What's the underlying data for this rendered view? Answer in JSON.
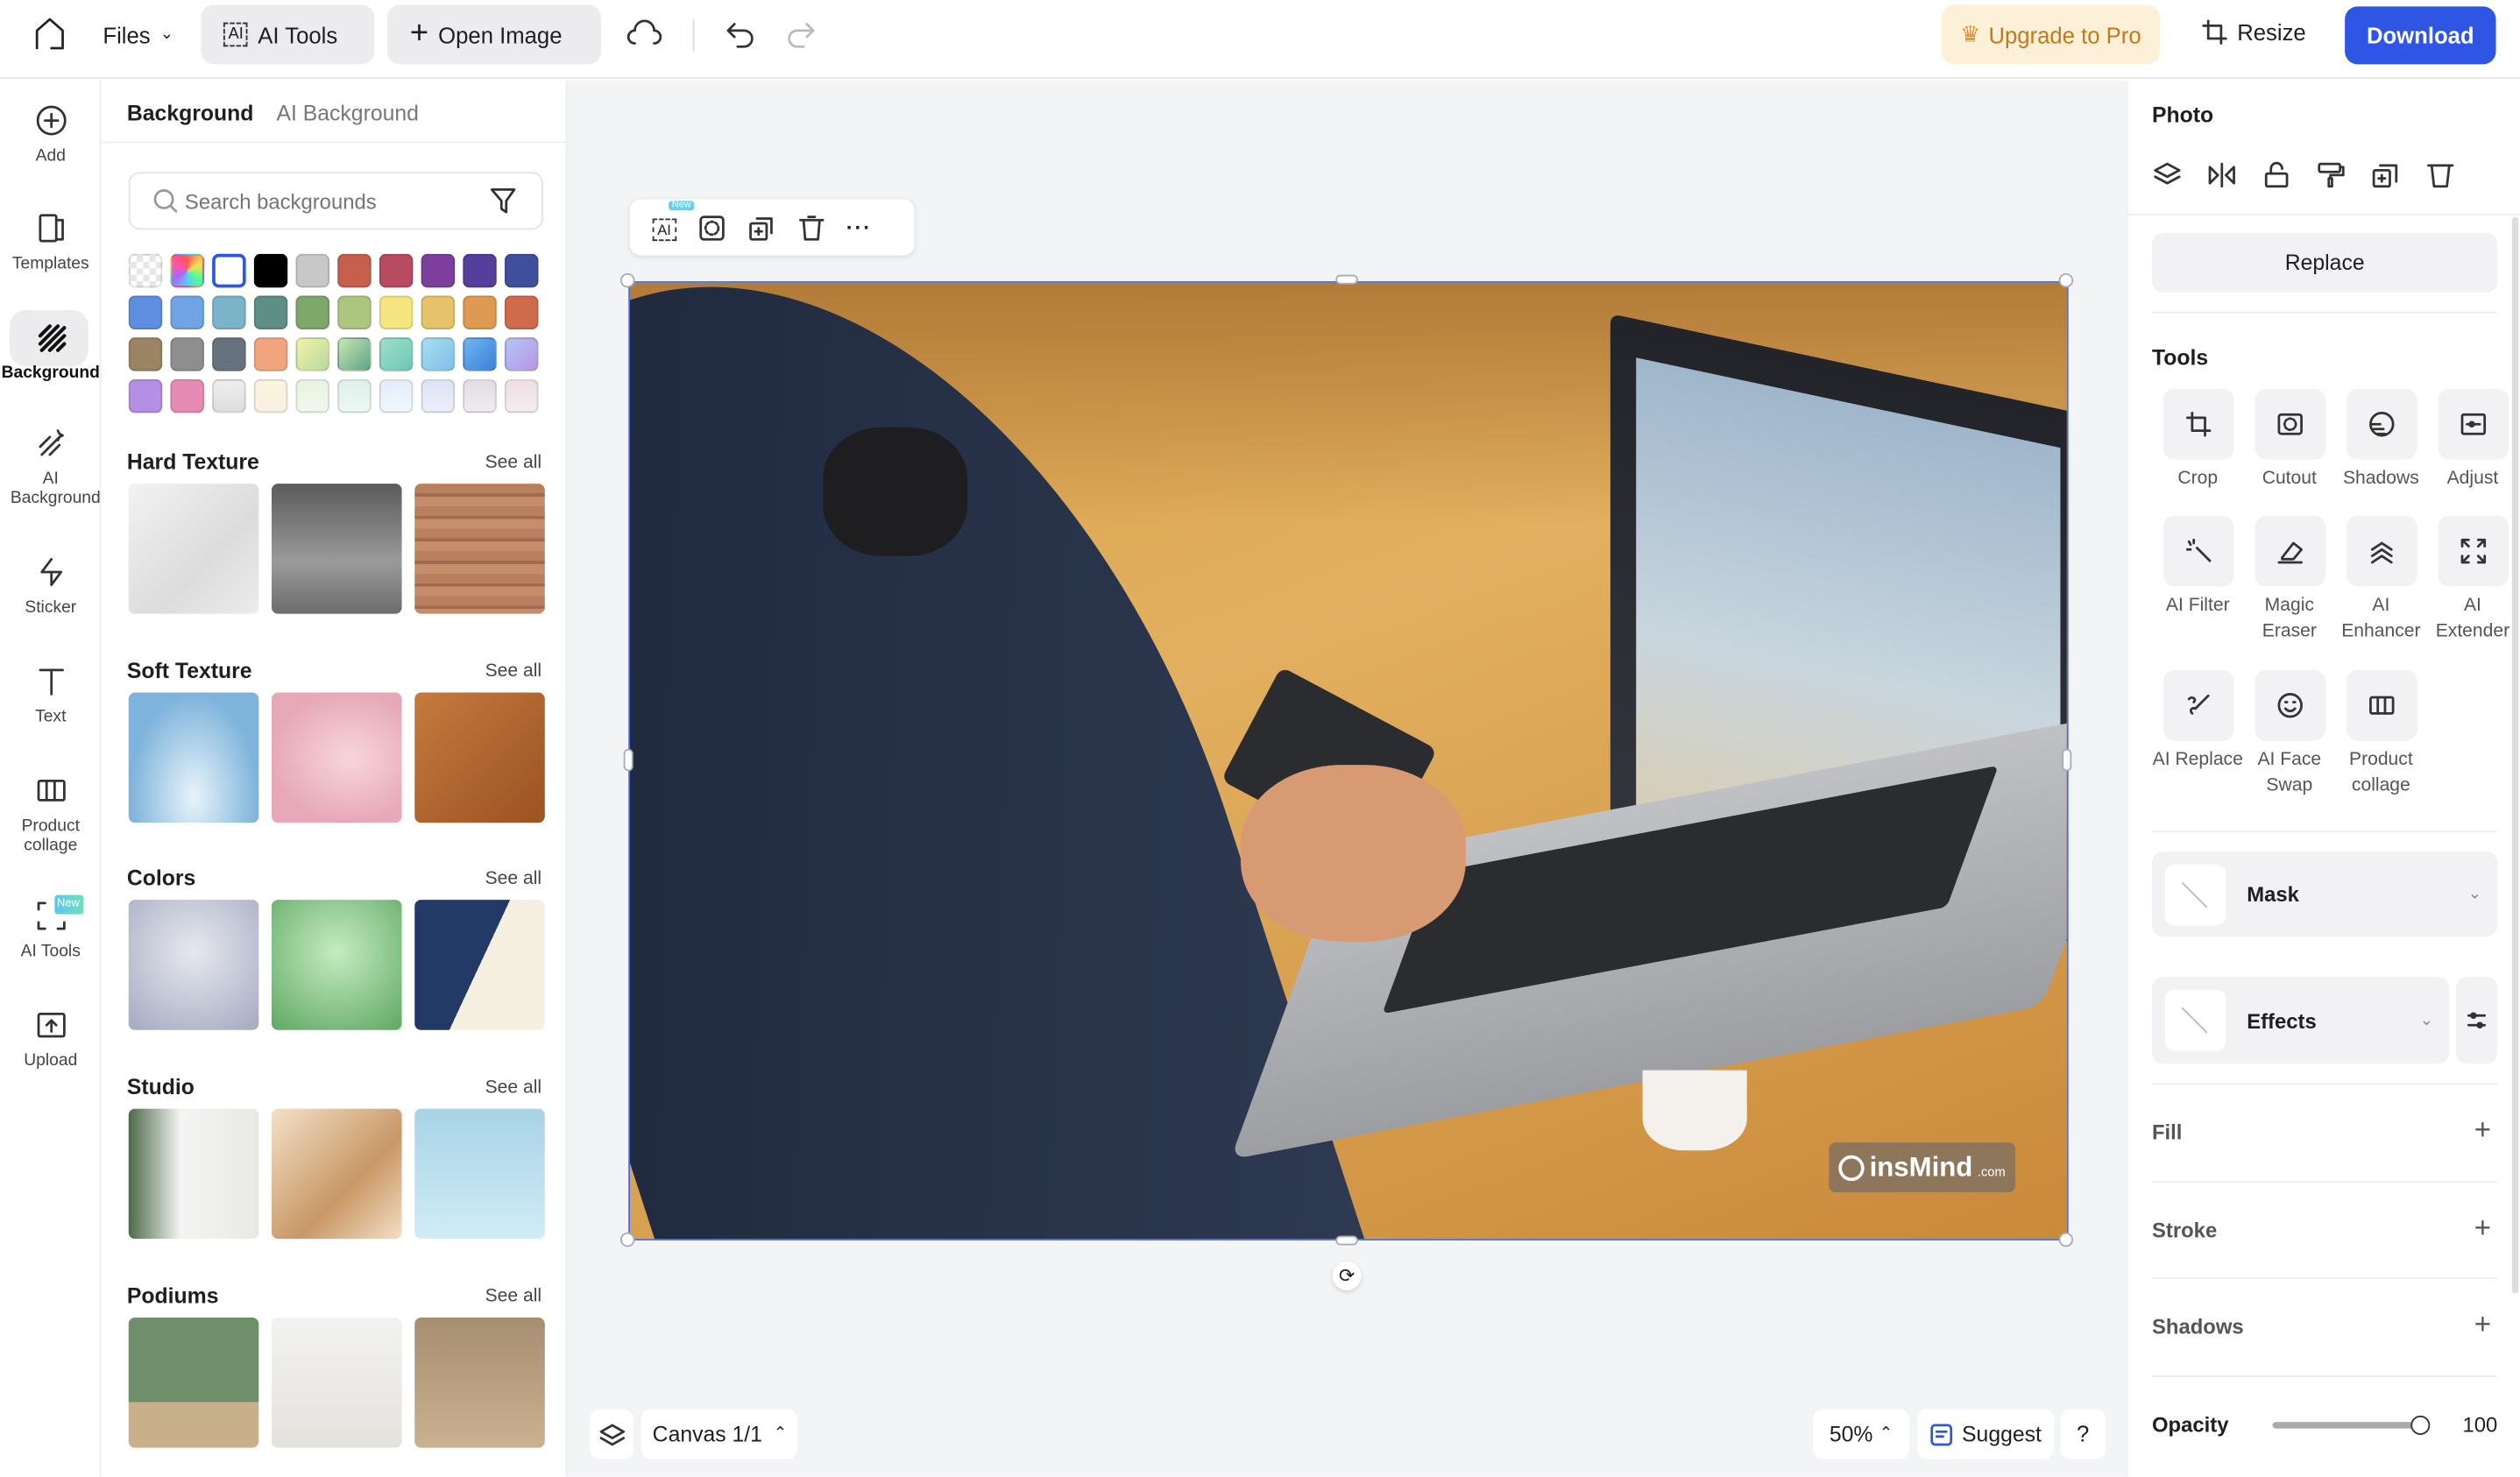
{
  "topbar": {
    "files": "Files",
    "ai_tools": "AI Tools",
    "open_image": "Open Image",
    "upgrade": "Upgrade to Pro",
    "resize": "Resize",
    "download": "Download",
    "colors": {
      "download_bg": "#2f55e4",
      "upgrade_bg": "#fdf0d9",
      "upgrade_text": "#c07a1a"
    }
  },
  "rail": {
    "items": [
      {
        "label": "Add",
        "icon": "plus-circle-icon"
      },
      {
        "label": "Templates",
        "icon": "templates-icon"
      },
      {
        "label": "Background",
        "icon": "background-icon",
        "active": true
      },
      {
        "label": "AI Background",
        "icon": "ai-background-icon"
      },
      {
        "label": "Sticker",
        "icon": "sticker-icon"
      },
      {
        "label": "Text",
        "icon": "text-icon"
      },
      {
        "label": "Product collage",
        "icon": "collage-icon"
      },
      {
        "label": "AI Tools",
        "icon": "ai-tools-icon",
        "badge": "New"
      },
      {
        "label": "Upload",
        "icon": "upload-icon"
      }
    ]
  },
  "panel": {
    "tabs": [
      "Background",
      "AI Background"
    ],
    "search_placeholder": "Search backgrounds",
    "swatches": [
      "transparent",
      "rainbow",
      "#ffffff",
      "#000000",
      "#c8c8c8",
      "#c4604c",
      "#b84b62",
      "#7d3f9c",
      "#553f9c",
      "#3f4f9c",
      "#5f8ee0",
      "#6fa3e4",
      "#7db3c9",
      "#5f8e84",
      "#7ea86a",
      "#adc67f",
      "#f4e57f",
      "#e6c26a",
      "#dd9a50",
      "#cf6b4a",
      "#9a8463",
      "#8e8e8e",
      "#66737f",
      "#f0a57c",
      "linear-gradient(135deg,#f6f0a8,#b5dba0)",
      "linear-gradient(135deg,#c9e6b0,#5ea38a)",
      "linear-gradient(135deg,#9ce0c6,#6fc7b8)",
      "linear-gradient(135deg,#a6def0,#80c0e8)",
      "linear-gradient(135deg,#6fb6f0,#3d7fd9)",
      "linear-gradient(135deg,#b3c5f2,#b796e6)",
      "#b58fe3",
      "#e58bb4",
      "linear-gradient(#eee,#ddd)",
      "linear-gradient(#fdf4dc,#f8f0e2)",
      "linear-gradient(#e8f3e0,#f2f7ee)",
      "linear-gradient(#def0ea,#eef6f3)",
      "linear-gradient(#e3eef9,#f1f6fc)",
      "linear-gradient(#dde3f6,#eceff9)",
      "linear-gradient(#e2dde4,#efecef)",
      "linear-gradient(#efdfe5,#f5edf0)"
    ],
    "see_all": "See all",
    "sections": [
      {
        "title": "Hard Texture",
        "tiles": [
          "linear-gradient(135deg,#f2f2f2,#dcdcdc 60%,#ececec)",
          "linear-gradient(#5b5b5b,#9a9a9a 60%,#6c6c6c)",
          "repeating-linear-gradient(#b98060 0 6px,#a26a4d 6px 8px,#c48d6c 8px 14px)"
        ]
      },
      {
        "title": "Soft Texture",
        "tiles": [
          "radial-gradient(ellipse at 50% 80%,#e7f4fb,#7eb3db 70%)",
          "radial-gradient(ellipse at 60% 50%,#f8d5dc,#e7a9b8 70%)",
          "linear-gradient(135deg,#c57a3e,#9c5222)"
        ]
      },
      {
        "title": "Colors",
        "tiles": [
          "radial-gradient(circle at 50% 40%,#e6e8f0,#a4aac0)",
          "radial-gradient(circle at 50% 40%,#c5ecc0,#5fa863)",
          "linear-gradient(115deg,#233a66 50%,#f5efdf 50%)"
        ]
      },
      {
        "title": "Studio",
        "tiles": [
          "linear-gradient(90deg,#4c6a48,#f4f4f2 40%,#e8e8e4)",
          "linear-gradient(135deg,#f4e1c8,#c89766 60%,#f3dfc4)",
          "linear-gradient(#a8d3e6,#d0ecf6)"
        ]
      },
      {
        "title": "Podiums",
        "tiles": [
          "linear-gradient(#6f8f6a 65%,#c8b08a 65%)",
          "linear-gradient(#f2f2f0,#e4e2dd)",
          "linear-gradient(#a88e70,#c9b191)"
        ]
      }
    ]
  },
  "canvas": {
    "toolbar_badge": "New",
    "watermark": "insMind",
    "watermark_suffix": ".com",
    "page": "Canvas 1/1",
    "zoom": "50%",
    "suggest": "Suggest",
    "help": "?",
    "selection_color": "#4a6ee0"
  },
  "right": {
    "title": "Photo",
    "replace": "Replace",
    "tools_title": "Tools",
    "tools": [
      {
        "label": "Crop",
        "icon": "crop-icon"
      },
      {
        "label": "Cutout",
        "icon": "cutout-icon"
      },
      {
        "label": "Shadows",
        "icon": "shadows-icon"
      },
      {
        "label": "Adjust",
        "icon": "adjust-icon"
      },
      {
        "label": "AI Filter",
        "icon": "ai-filter-icon"
      },
      {
        "label": "Magic Eraser",
        "icon": "eraser-icon"
      },
      {
        "label": "AI Enhancer",
        "icon": "enhancer-icon"
      },
      {
        "label": "AI Extender",
        "icon": "extender-icon"
      },
      {
        "label": "AI Replace",
        "icon": "ai-replace-icon"
      },
      {
        "label": "AI Face Swap",
        "icon": "face-swap-icon"
      },
      {
        "label": "Product collage",
        "icon": "collage-icon"
      }
    ],
    "mask": "Mask",
    "effects": "Effects",
    "fill": "Fill",
    "stroke": "Stroke",
    "shadows": "Shadows",
    "opacity_label": "Opacity",
    "opacity": 100
  }
}
